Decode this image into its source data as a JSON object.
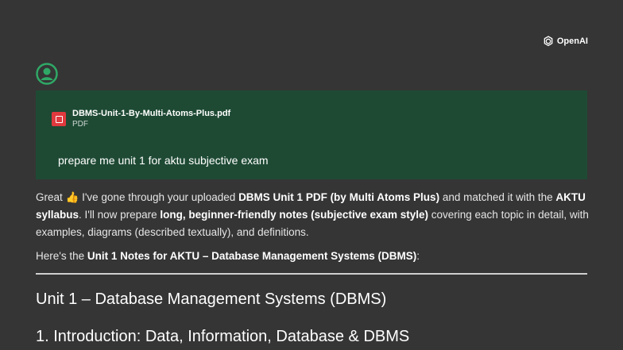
{
  "brand": {
    "name": "OpenAI"
  },
  "user_message": {
    "attachment": {
      "file_name": "DBMS-Unit-1-By-Multi-Atoms-Plus.pdf",
      "file_type": "PDF"
    },
    "text": "prepare me unit 1 for aktu subjective exam"
  },
  "assistant": {
    "p1": {
      "s1": "Great ",
      "emoji": "👍",
      "s2": " I've gone through your uploaded ",
      "b1": "DBMS Unit 1 PDF (by Multi Atoms Plus)",
      "s3": " and matched it with the ",
      "b2": "AKTU syllabus",
      "s4": ". I'll now prepare ",
      "b3": "long, beginner-friendly notes (subjective exam style)",
      "s5": " covering each topic in detail, with examples, diagrams (described textually), and definitions."
    },
    "p2": {
      "s1": "Here's the ",
      "b1": "Unit 1 Notes for AKTU – Database Management Systems (DBMS)",
      "s2": ":"
    },
    "heading1": "Unit 1 – Database Management Systems (DBMS)",
    "heading2": "1. Introduction: Data, Information, Database & DBMS"
  },
  "colors": {
    "background": "#353535",
    "user_bubble": "#1e4a34",
    "avatar": "#2fa866",
    "pdf_icon": "#e0393e"
  },
  "icons": {
    "brand": "openai-logo-icon",
    "avatar": "user-avatar-icon",
    "file": "pdf-file-icon"
  }
}
